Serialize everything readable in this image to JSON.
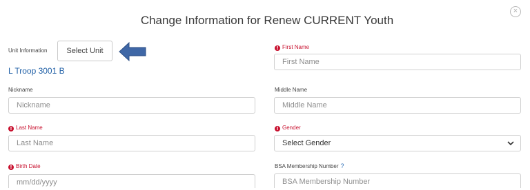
{
  "modal": {
    "title": "Change Information for Renew CURRENT Youth",
    "close_glyph": "×"
  },
  "unit": {
    "label": "Unit Information",
    "button_label": "Select Unit",
    "current_unit": "L Troop 3001 B",
    "pointer_icon": "arrow-left-icon"
  },
  "fields": {
    "first_name": {
      "label": "First Name",
      "placeholder": "First Name",
      "required": true
    },
    "nickname": {
      "label": "Nickname",
      "placeholder": "Nickname",
      "required": false
    },
    "middle_name": {
      "label": "Middle Name",
      "placeholder": "Middle Name",
      "required": false
    },
    "last_name": {
      "label": "Last Name",
      "placeholder": "Last Name",
      "required": true
    },
    "gender": {
      "label": "Gender",
      "selected": "Select Gender",
      "required": true
    },
    "birth_date": {
      "label": "Birth Date",
      "placeholder": "mm/dd/yyyy",
      "required": true
    },
    "bsa_number": {
      "label": "BSA Membership Number",
      "placeholder": "BSA Membership Number",
      "help": "?",
      "required": false
    }
  },
  "colors": {
    "required": "#c8102e",
    "link": "#1f5fa6",
    "arrow": "#3f67a6",
    "border": "#cfcfcf"
  }
}
